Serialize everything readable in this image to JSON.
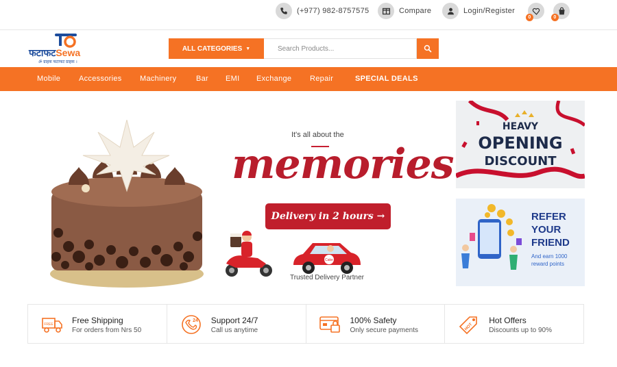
{
  "topbar": {
    "phone": "(+977) 982-8757575",
    "compare": "Compare",
    "login": "Login/Register",
    "wishlist_count": "0",
    "cart_count": "0"
  },
  "logo": {
    "main": "फटाफट",
    "sewa": "Sewa",
    "tagline": "ॐ ग्राहक फटाफट ग्राहक ।"
  },
  "search": {
    "category_label": "ALL CATEGORIES",
    "placeholder": "Search Products..."
  },
  "nav": {
    "items": [
      "Mobile",
      "Accessories",
      "Machinery",
      "Bar",
      "EMI",
      "Exchange",
      "Repair"
    ],
    "special": "SPECIAL DEALS"
  },
  "hero": {
    "tagline": "It's all about the",
    "title": "memories",
    "button": "Delivery in 2 hours →",
    "partner": "Trusted Delivery Partner",
    "car_label": "Cake"
  },
  "banners": {
    "opening": {
      "line1": "HEAVY",
      "line2": "OPENING",
      "line3": "DISCOUNT"
    },
    "refer": {
      "line1": "REFER",
      "line2": "YOUR",
      "line3": "FRIEND",
      "line4": "And earn 1000",
      "line5": "reward points"
    }
  },
  "features": [
    {
      "icon": "truck-icon",
      "badge": "FREE",
      "title": "Free Shipping",
      "subtitle": "For orders from Nrs 50"
    },
    {
      "icon": "support-icon",
      "badge": "24",
      "title": "Support 24/7",
      "subtitle": "Call us anytime"
    },
    {
      "icon": "card-safety-icon",
      "title": "100% Safety",
      "subtitle": "Only secure payments"
    },
    {
      "icon": "tag-icon",
      "badge": "HOT",
      "title": "Hot Offers",
      "subtitle": "Discounts up to 90%"
    }
  ],
  "colors": {
    "accent": "#f57224",
    "brand_blue": "#1c4c9c",
    "hero_red": "#b81d2c"
  }
}
